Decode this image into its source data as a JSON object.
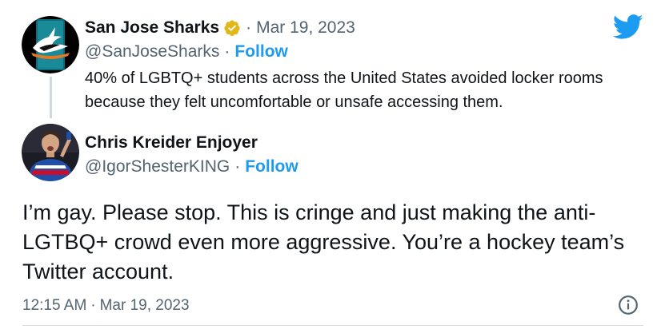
{
  "brand": {
    "logo_icon": "twitter-bird-icon",
    "twitter_blue": "#1d9bf0",
    "verified_gold": "#e2b719"
  },
  "parent_tweet": {
    "display_name": "San Jose Sharks",
    "verified_icon": "gold-verified-badge-icon",
    "separator": "·",
    "date": "Mar 19, 2023",
    "handle": "@SanJoseSharks",
    "follow_separator": "·",
    "follow_label": "Follow",
    "text": "40% of LGBTQ+ students across the United States avoided locker rooms because they felt uncomfortable or unsafe accessing them.",
    "avatar_icon": "sharks-logo-avatar"
  },
  "reply_tweet": {
    "display_name": "Chris Kreider Enjoyer",
    "handle": "@IgorShesterKING",
    "follow_separator": "·",
    "follow_label": "Follow",
    "text": "I’m gay. Please stop. This is cringe and just making the anti-LGTBQ+ crowd even more aggressive. You’re a hockey team’s Twitter account.",
    "avatar_icon": "hockey-player-avatar"
  },
  "footer": {
    "time": "12:15 AM",
    "separator": "·",
    "date": "Mar 19, 2023",
    "info_icon": "info-icon"
  }
}
